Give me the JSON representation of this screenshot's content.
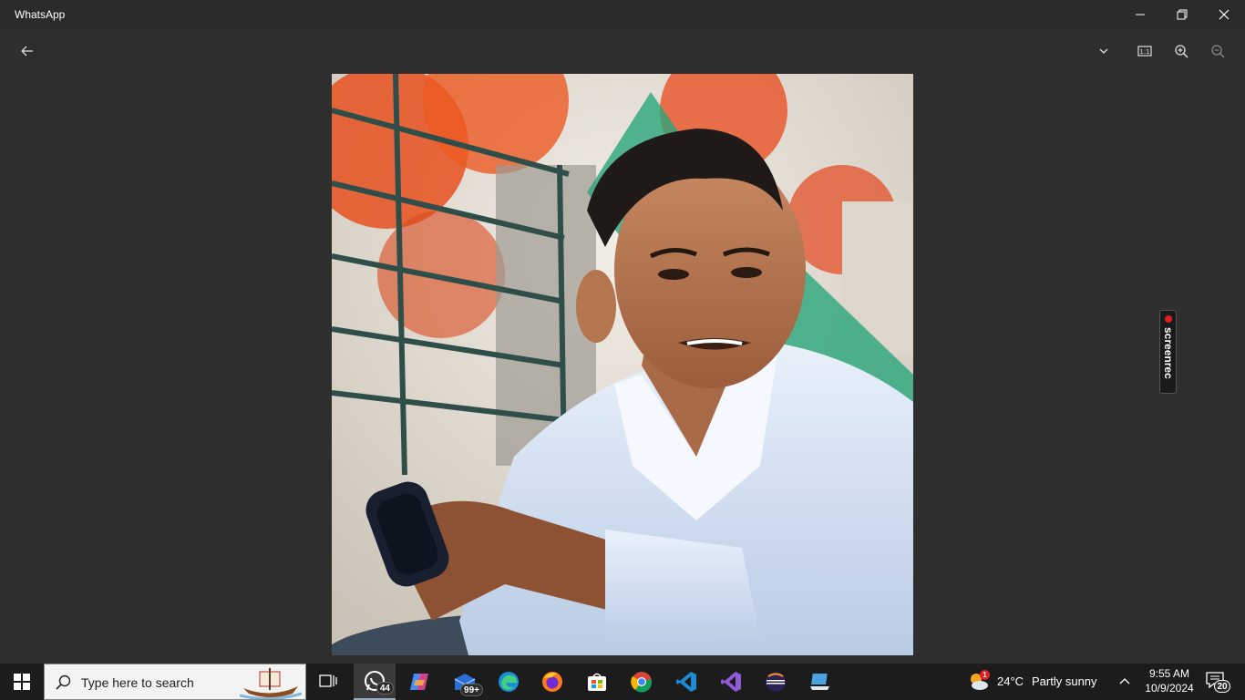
{
  "window": {
    "title": "WhatsApp"
  },
  "taskbar": {
    "search_placeholder": "Type here to search",
    "whatsapp_badge": "44",
    "mail_badge": "99+",
    "weather_badge": "1",
    "temperature": "24°C",
    "weather": "Partly sunny",
    "time": "9:55 AM",
    "date": "10/9/2024",
    "notifications": "20"
  },
  "overlay": {
    "screenrec_label": "screenrec"
  },
  "icons": {
    "back": "arrow-left-icon",
    "dropdown": "chevron-down-icon",
    "actual_size": "actual-size-icon",
    "zoom_in": "zoom-in-icon",
    "zoom_out": "zoom-out-icon"
  }
}
